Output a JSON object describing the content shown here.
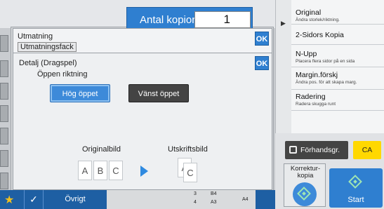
{
  "header": {
    "copies_label": "Antal kopior",
    "copies_value": "1"
  },
  "output_dialog": {
    "title": "Utmatning",
    "subtitle": "Utmatningsfack",
    "ok": "OK"
  },
  "detail_dialog": {
    "title": "Detalj (Dragspel)",
    "open_direction_label": "Öppen riktning",
    "btn_top": "Hög öppet",
    "btn_left": "Vänst öppet",
    "ok": "OK",
    "original_label": "Originalbild",
    "output_label": "Utskriftsbild",
    "original_pages": [
      "A",
      "B",
      "C"
    ],
    "output_pages": [
      "A",
      "C"
    ]
  },
  "right_panel": {
    "items": [
      {
        "main": "Original",
        "sub": "Ändra storlek/riktning."
      },
      {
        "main": "2-Sidors Kopia",
        "sub": ""
      },
      {
        "main": "N-Upp",
        "sub": "Placera flera sidor på en sida"
      },
      {
        "main": "Margin.förskj",
        "sub": "Ändra pos. för att skapa marg."
      },
      {
        "main": "Radering",
        "sub": "Radera skugga runt"
      }
    ]
  },
  "actions": {
    "preview": "Förhandsgr.",
    "ca": "CA",
    "proof": "Korrektur-kopia",
    "start": "Start"
  },
  "bottombar": {
    "other": "Övrigt",
    "tray": {
      "t1": "3",
      "t2": "4",
      "s1": "B4",
      "s2": "A3",
      "s3": "A4"
    }
  },
  "colors": {
    "accent": "#2f7fd0",
    "ca": "#ffd800",
    "bar": "#1e5fa3"
  }
}
